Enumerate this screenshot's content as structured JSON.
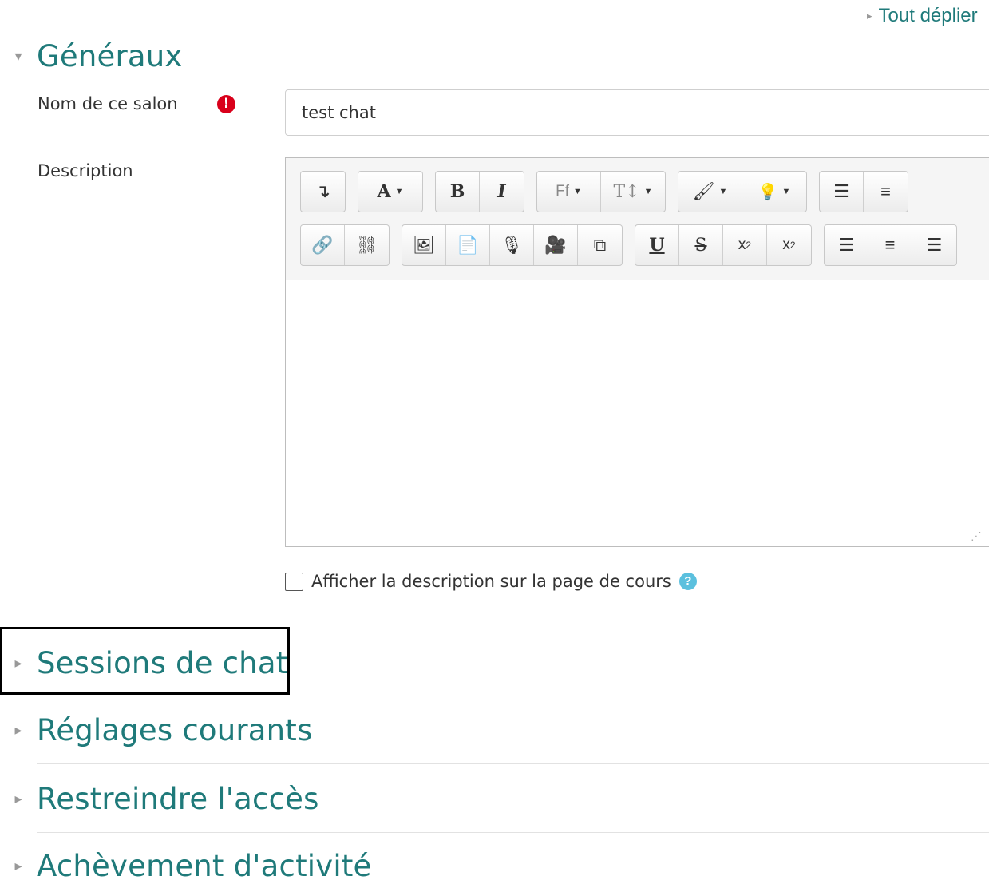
{
  "expand_all": "Tout déplier",
  "sections": {
    "general": "Généraux",
    "chat_sessions": "Sessions de chat",
    "common_settings": "Réglages courants",
    "restrict_access": "Restreindre l'accès",
    "activity_completion": "Achèvement d'activité"
  },
  "form": {
    "name_label": "Nom de ce salon",
    "name_value": "test chat",
    "description_label": "Description",
    "show_description_label": "Afficher la description sur la page de cours"
  },
  "toolbar_icons": {
    "row1": [
      "toggle-toolbar-icon",
      "paragraph-style-icon",
      "bold-icon",
      "italic-icon",
      "font-family-icon",
      "font-size-icon",
      "font-color-icon",
      "background-color-icon",
      "unordered-list-icon",
      "ordered-list-icon"
    ],
    "row2": [
      "link-icon",
      "unlink-icon",
      "image-icon",
      "media-icon",
      "record-audio-icon",
      "record-video-icon",
      "manage-files-icon",
      "underline-icon",
      "strikethrough-icon",
      "subscript-icon",
      "superscript-icon",
      "align-left-icon",
      "align-center-icon",
      "align-right-icon"
    ]
  },
  "colors": {
    "accent": "#1f7a7a",
    "required": "#d9001b",
    "help": "#5bc0de"
  }
}
